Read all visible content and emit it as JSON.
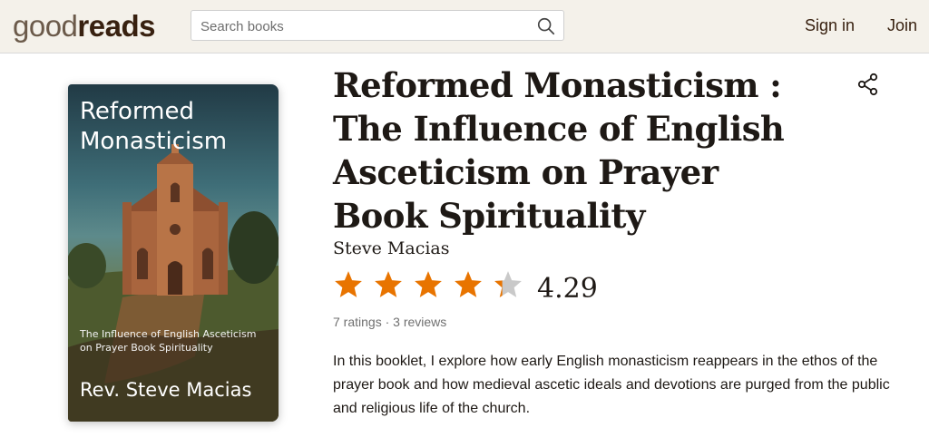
{
  "header": {
    "logo_light": "good",
    "logo_bold": "reads",
    "search_placeholder": "Search books",
    "sign_in": "Sign in",
    "join": "Join"
  },
  "cover": {
    "title": "Reformed Monasticism",
    "subtitle": "The Influence of English Asceticism on Prayer Book Spirituality",
    "author": "Rev. Steve Macias"
  },
  "book": {
    "title": "Reformed Monasticism : The Influence of English Asceticism on Prayer Book Spirituality",
    "author": "Steve Macias",
    "average_rating": "4.29",
    "rating_value": 4.29,
    "ratings_count": "7 ratings",
    "separator": " · ",
    "reviews_count": "3 reviews",
    "description": "In this booklet, I explore how early English monasticism reappears in the ethos of the prayer book and how medieval ascetic ideals and devotions are purged from the public and religious life of the church."
  },
  "colors": {
    "star_filled": "#e87400",
    "star_empty": "#c9c9c9",
    "header_bg": "#f4f1ea"
  },
  "icons": [
    "search-icon",
    "share-icon",
    "star-icon"
  ]
}
